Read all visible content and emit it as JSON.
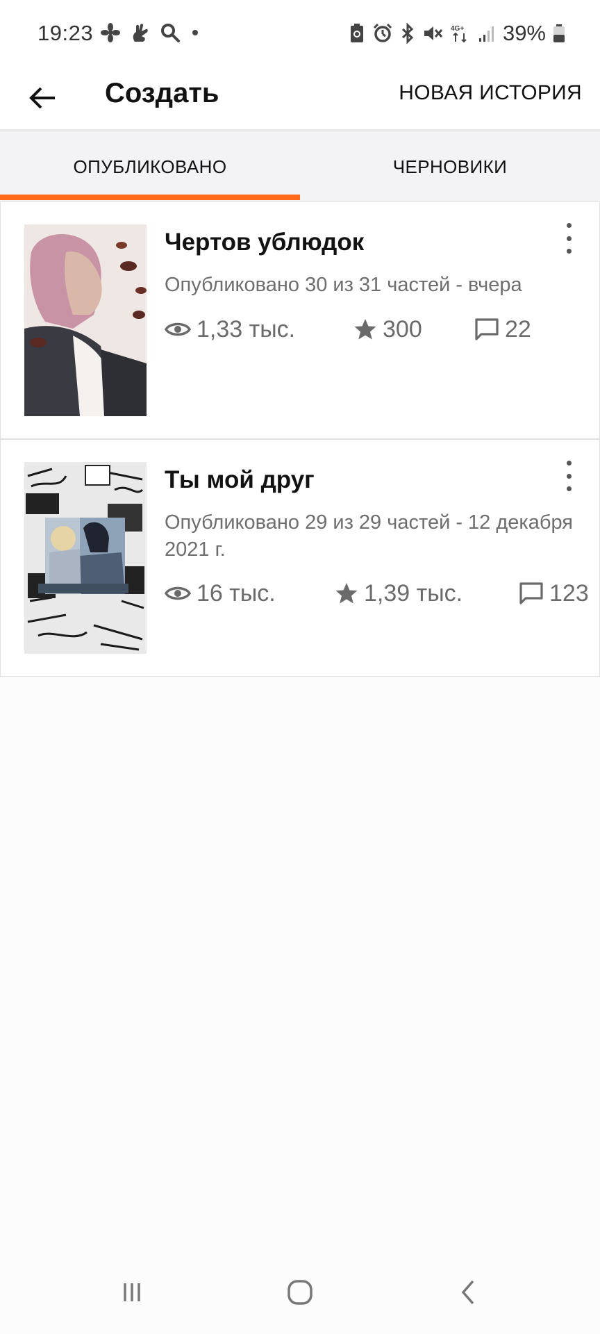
{
  "status_bar": {
    "time": "19:23",
    "battery": "39%",
    "network_label": "4G+"
  },
  "app_bar": {
    "title": "Создать",
    "action_label": "НОВАЯ ИСТОРИЯ"
  },
  "tabs": [
    {
      "label": "ОПУБЛИКОВАНО",
      "active": true
    },
    {
      "label": "ЧЕРНОВИКИ",
      "active": false
    }
  ],
  "accent_color": "#ff6a1a",
  "stories": [
    {
      "title": "Чертов ублюдок",
      "meta": "Опубликовано 30 из 31 частей - вчера",
      "views": "1,33 тыс.",
      "votes": "300",
      "comments": "22"
    },
    {
      "title": "Ты мой друг",
      "meta": "Опубликовано 29 из 29 частей - 12 декабря 2021 г.",
      "views": "16 тыс.",
      "votes": "1,39 тыс.",
      "comments": "123"
    }
  ],
  "icons": {
    "back": "arrow-left-icon",
    "views": "eye-icon",
    "votes": "star-icon",
    "comments": "comment-icon",
    "more": "more-vertical-icon"
  }
}
